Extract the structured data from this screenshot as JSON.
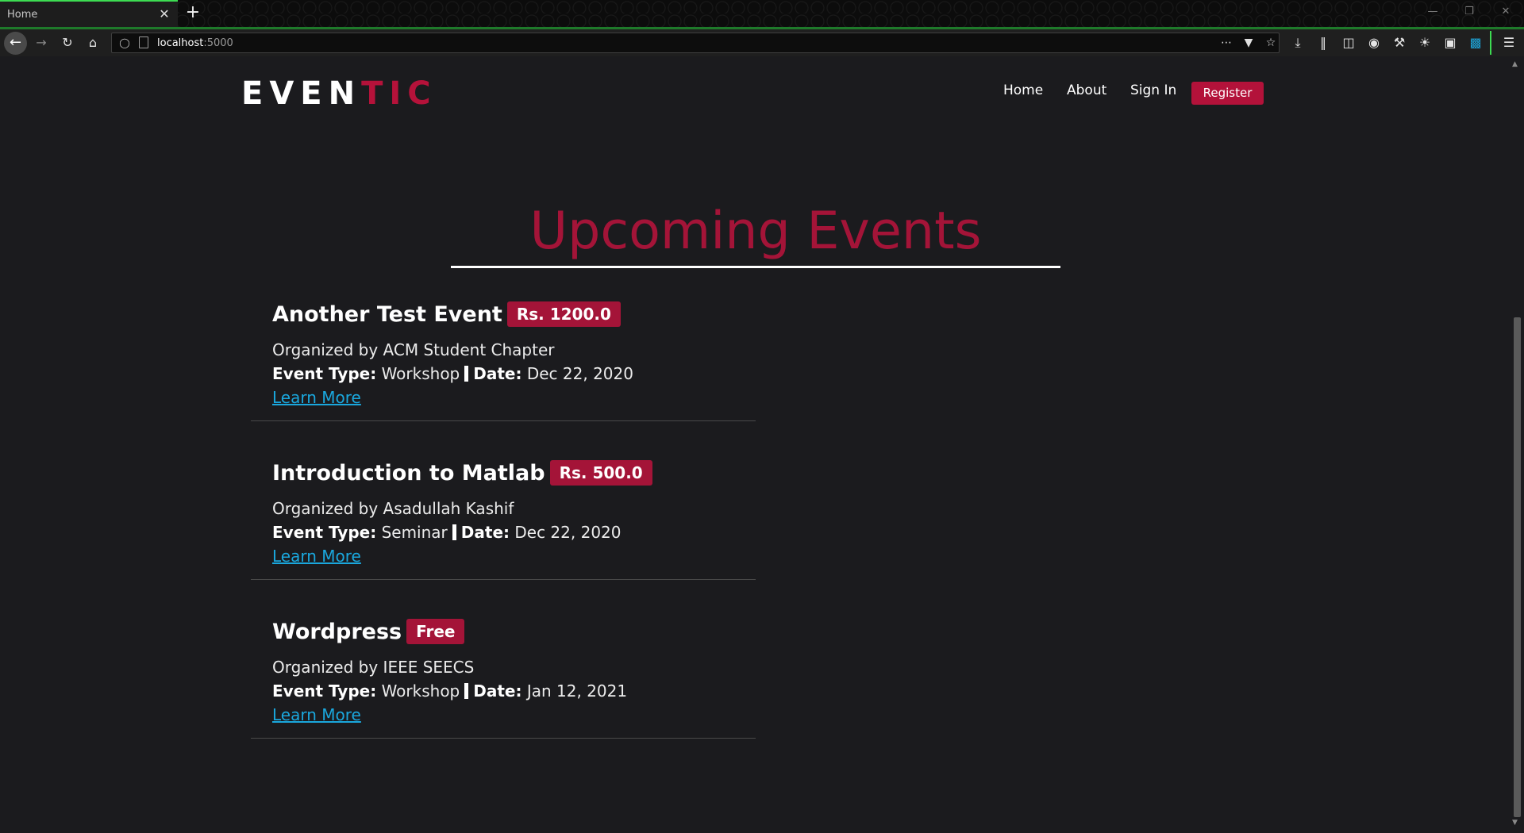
{
  "browser": {
    "tab_title": "Home",
    "tab_close": "✕",
    "new_tab": "+",
    "url_host": "localhost",
    "url_port": ":5000",
    "icons": [
      "back-arrow-icon",
      "forward-arrow-icon",
      "reload-icon",
      "home-icon",
      "shield-icon",
      "page-icon",
      "more-icon",
      "pocket-icon",
      "bookmark-star-icon",
      "download-icon",
      "library-icon",
      "sidebar-icon",
      "account-icon",
      "wrench-icon",
      "sun-icon",
      "screenshot-icon",
      "save-icon",
      "menu-icon"
    ]
  },
  "site": {
    "logo_main": "EVEN",
    "logo_accent": "TIC",
    "accent_color": "#b3123a",
    "link_color": "#1aa7dd",
    "nav": {
      "home": "Home",
      "about": "About",
      "sign_in": "Sign In",
      "register": "Register"
    },
    "heading": "Upcoming Events"
  },
  "events": [
    {
      "title": "Another Test Event",
      "price": "Rs. 1200.0",
      "organizer": "Organized by ACM Student Chapter",
      "type_label": "Event Type:",
      "type": "Workshop",
      "date_label": "Date:",
      "date": "Dec 22, 2020",
      "link": "Learn More"
    },
    {
      "title": "Introduction to Matlab",
      "price": "Rs. 500.0",
      "organizer": "Organized by Asadullah Kashif",
      "type_label": "Event Type:",
      "type": "Seminar",
      "date_label": "Date:",
      "date": "Dec 22, 2020",
      "link": "Learn More"
    },
    {
      "title": "Wordpress",
      "price": "Free",
      "organizer": "Organized by IEEE SEECS",
      "type_label": "Event Type:",
      "type": "Workshop",
      "date_label": "Date:",
      "date": "Jan 12, 2021",
      "link": "Learn More"
    }
  ]
}
